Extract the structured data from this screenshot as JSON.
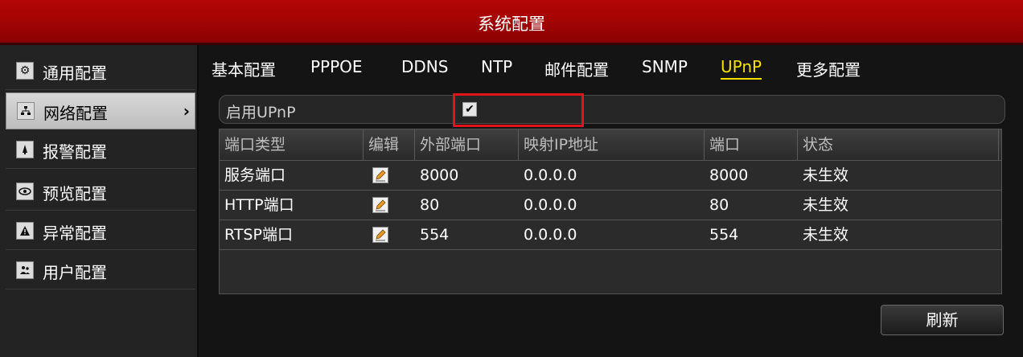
{
  "window": {
    "title": "系统配置"
  },
  "sidebar": {
    "items": [
      {
        "label": "通用配置",
        "icon": "gear-icon"
      },
      {
        "label": "网络配置",
        "icon": "network-icon",
        "active": true,
        "arrow": "›"
      },
      {
        "label": "报警配置",
        "icon": "alarm-icon"
      },
      {
        "label": "预览配置",
        "icon": "eye-icon"
      },
      {
        "label": "异常配置",
        "icon": "warning-icon"
      },
      {
        "label": "用户配置",
        "icon": "users-icon"
      }
    ]
  },
  "tabs": [
    {
      "label": "基本配置"
    },
    {
      "label": "PPPOE"
    },
    {
      "label": "DDNS"
    },
    {
      "label": "NTP"
    },
    {
      "label": "邮件配置"
    },
    {
      "label": "SNMP"
    },
    {
      "label": "UPnP",
      "active": true
    },
    {
      "label": "更多配置"
    }
  ],
  "upnp": {
    "label": "启用UPnP",
    "checked": true
  },
  "table": {
    "headers": [
      "端口类型",
      "编辑",
      "外部端口",
      "映射IP地址",
      "端口",
      "状态"
    ],
    "rows": [
      {
        "type": "服务端口",
        "ext_port": "8000",
        "ip": "0.0.0.0",
        "port": "8000",
        "status": "未生效"
      },
      {
        "type": "HTTP端口",
        "ext_port": "80",
        "ip": "0.0.0.0",
        "port": "80",
        "status": "未生效"
      },
      {
        "type": "RTSP端口",
        "ext_port": "554",
        "ip": "0.0.0.0",
        "port": "554",
        "status": "未生效"
      }
    ]
  },
  "buttons": {
    "refresh": "刷新"
  },
  "colors": {
    "title_bar": "#a50404",
    "active_tab": "#f5e000",
    "highlight": "#e0151b"
  }
}
